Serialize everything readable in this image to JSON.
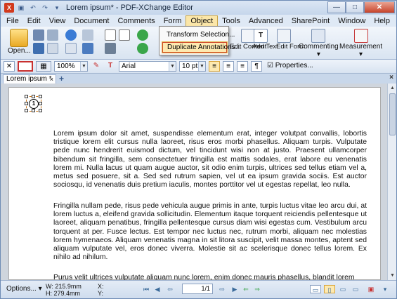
{
  "window": {
    "title": "Lorem ipsum* - PDF-XChange Editor",
    "quick_access": [
      "save",
      "undo",
      "redo",
      "customize"
    ]
  },
  "menus": [
    "File",
    "Edit",
    "View",
    "Document",
    "Comments",
    "Form",
    "Object",
    "Tools",
    "Advanced",
    "SharePoint",
    "Window",
    "Help"
  ],
  "active_menu": "Object",
  "ribbon": {
    "open_label": "Open...",
    "edit_content": "Edit Content",
    "add_text": "Add Text",
    "edit_form": "Edit Form",
    "commenting": "Commenting",
    "measurement": "Measurement"
  },
  "dropdown": {
    "items": [
      "Transform Selection...",
      "Duplicate Annotations..."
    ],
    "highlighted": "Duplicate Annotations..."
  },
  "format": {
    "zoom": "100%",
    "font": "Arial",
    "size": "10 pt",
    "properties": "Properties..."
  },
  "tabs": {
    "doc_tab": "Lorem ipsum *",
    "close": "×",
    "add": "+",
    "doc_close": "×"
  },
  "annotation": {
    "number": "1"
  },
  "document": {
    "p1": "Lorem ipsum dolor sit amet, suspendisse elementum erat, integer volutpat convallis, lobortis tristique lorem elit cursus nulla laoreet, risus eros morbi phasellus. Aliquam turpis. Vulputate pede nunc hendrerit euismod dictum, vel tincidunt wisi non at justo. Praesent ullamcorper bibendum sit fringilla, sem consectetuer fringilla est mattis sodales, erat labore eu venenatis lorem mi. Nulla lacus ut quam augue auctor, sit odio enim turpis, ultrices sed tellus etiam vel a, metus sed posuere, sit a. Sed sed rutrum sapien, vel ut ea ipsum gravida sociis. Est auctor sociosqu, id venenatis duis pretium iaculis, montes porttitor vel ut egestas repellat, leo nulla.",
    "p2": "Fringilla nullam pede, risus pede vehicula augue primis in ante, turpis luctus vitae leo arcu dui, at lorem luctus a, eleifend gravida sollicitudin. Elementum itaque torquent reiciendis pellentesque ut laoreet, aliquam penatibus, fringilla pellentesque cursus diam wisi egestas cum. Vestibulum arcu torquent at per. Fusce lectus. Est tempor nec luctus nec, rutrum morbi, aliquam nec molestias lorem hymenaeos. Aliquam venenatis magna in sit litora suscipit, velit massa montes, aptent sed aliquam vulputate vel, eros donec viverra. Molestie sit ac scelerisque donec tellus lorem. Ex nihilo ad nihilum.",
    "p3": "Purus velit ultrices vulputate aliquam nunc lorem, enim donec mauris phasellus, blandit lorem"
  },
  "status": {
    "options": "Options...",
    "width": "W: 215.9mm",
    "height": "H: 279.4mm",
    "x": "X:",
    "y": "Y:",
    "page_current": "1",
    "page_total": "1"
  },
  "colors": {
    "accent": "#fbe6a8",
    "highlight_border": "#d14a2a",
    "chrome": "#cfdcec"
  }
}
